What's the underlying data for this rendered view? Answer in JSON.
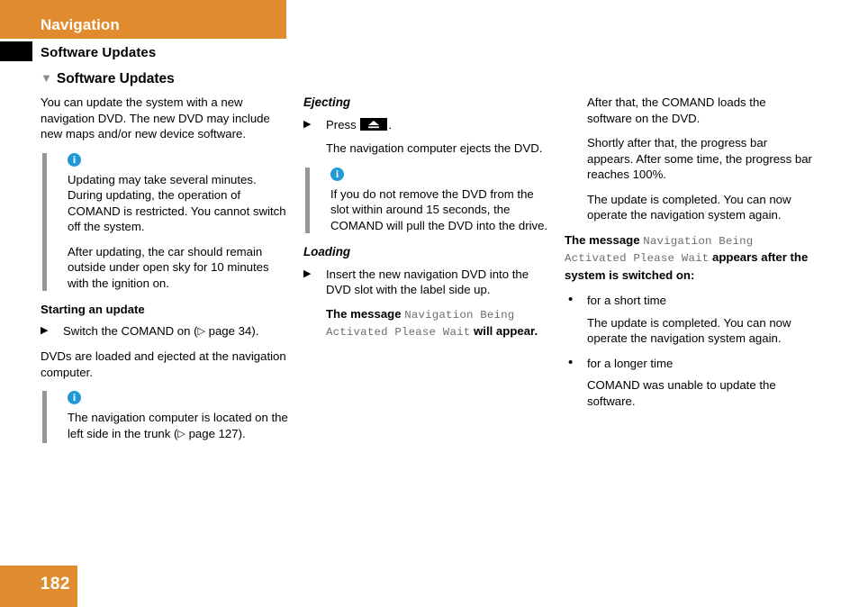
{
  "header": {
    "chapter_title": "Navigation",
    "running_head": "Software Updates",
    "band_color": "#e08b2d",
    "tab_color": "#000000"
  },
  "section": {
    "marker": "▼",
    "title": "Software Updates"
  },
  "icons": {
    "info": "info-icon",
    "step_marker": "▶",
    "bullet": "•",
    "page_ref": "▷",
    "eject": "⏏"
  },
  "columns": {
    "left": {
      "intro": "You can update the system with a new navigation DVD. The new DVD may include new maps and/or new device software.",
      "note1": {
        "paragraphs": [
          "Updating may take several minutes. During updating, the operation of COMAND is restricted. You cannot switch off the system.",
          "After updating, the car should remain outside under open sky for 10 minutes with the ignition on."
        ]
      },
      "subhead": "Starting an update",
      "step1_pre": "Switch the COMAND on (",
      "step1_ref": "page 34",
      "step1_post": ").",
      "para_after_step": "DVDs are loaded and ejected at the navigation computer.",
      "note2": {
        "text_pre": "The navigation computer is located on the left side in the trunk (",
        "text_ref": "page 127",
        "text_post": ")."
      }
    },
    "middle": {
      "subhead_ejecting": "Ejecting",
      "step_press_pre": "Press ",
      "step_press_post": ".",
      "step_press_result": "The navigation computer ejects the DVD.",
      "note": {
        "text": "If you do not remove the DVD from the slot within around 15 seconds, the COMAND will pull the DVD into the drive."
      },
      "subhead_loading": "Loading",
      "step_insert": "Insert the new navigation DVD into the DVD slot with the label side up.",
      "message_pre": "The message ",
      "message_mono": "Navigation Being Activated Please Wait",
      "message_post": " will appear."
    },
    "right": {
      "para1": "After that, the COMAND loads the software on the DVD.",
      "para2": "Shortly after that, the progress bar appears. After some time, the progress bar reaches 100%.",
      "para3": "The update is completed. You can now operate the navigation system again.",
      "message_pre": "The message ",
      "message_mono": "Navigation Being Activated Please Wait",
      "message_post": " appears after the system is switched on:",
      "bullets": [
        {
          "label": "for a short time",
          "detail": "The update is completed. You can now operate the navigation system again."
        },
        {
          "label": "for a longer time",
          "detail": "COMAND was unable to update the software."
        }
      ]
    }
  },
  "footer": {
    "page_number": "182",
    "band_color": "#e08b2d"
  }
}
